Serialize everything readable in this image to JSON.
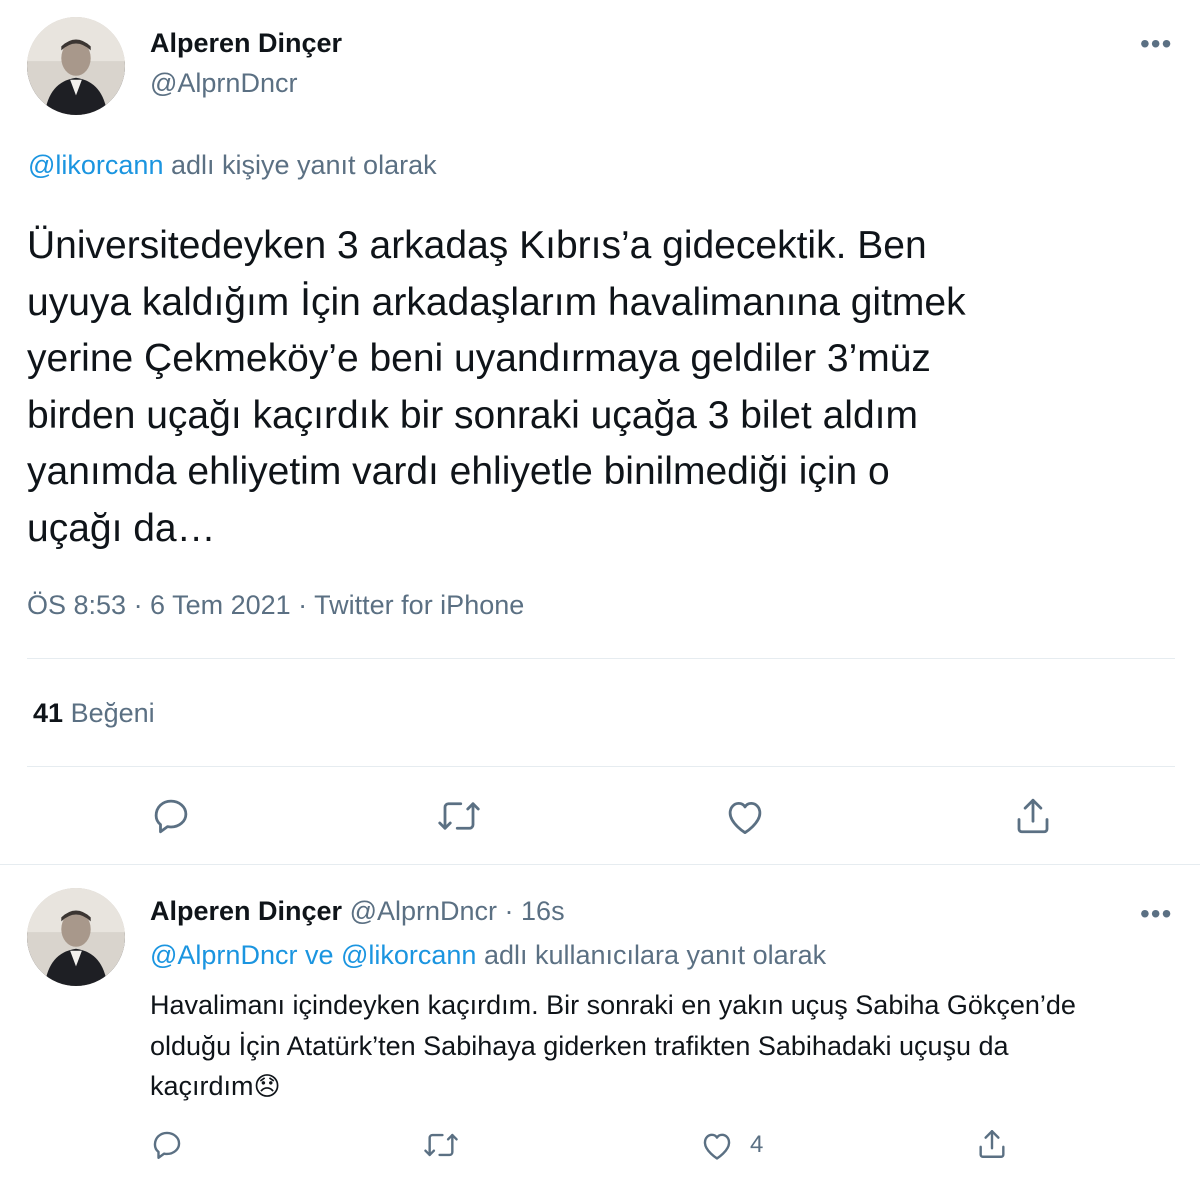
{
  "main_tweet": {
    "author_name": "Alperen Dinçer",
    "author_handle": "@AlprnDncr",
    "more_glyph": "•••",
    "reply_mention": "@likorcann",
    "reply_context_suffix": " adlı kişiye yanıt olarak",
    "text_lines": [
      "Üniversitedeyken 3 arkadaş Kıbrıs’a gidecektik. Ben",
      "uyuya kaldığım İçin arkadaşlarım havalimanına gitmek",
      "yerine Çekmeköy’e beni uyandırmaya geldiler 3’müz",
      "birden uçağı kaçırdık bir sonraki uçağa 3 bilet aldım",
      "yanımda ehliyetim vardı ehliyetle binilmediği için o",
      "uçağı da…"
    ],
    "meta": "ÖS 8:53 · 6 Tem 2021 · Twitter for iPhone",
    "likes_count": "41",
    "likes_label": "Beğeni"
  },
  "reply_tweet": {
    "author_name": "Alperen Dinçer",
    "author_handle": "@AlprnDncr",
    "time": "· 16s",
    "more_glyph": "•••",
    "mention_1": "@AlprnDncr",
    "mention_join": " ve ",
    "mention_2": "@likorcann",
    "reply_context_suffix": " adlı kullanıcılara yanıt olarak",
    "text_lines": [
      "Havalimanı içindeyken kaçırdım. Bir sonraki en yakın uçuş Sabiha Gökçen’de",
      "olduğu İçin Atatürk’ten Sabihaya giderken trafikten Sabihadaki uçuşu da",
      "kaçırdım"
    ],
    "emoji": "😞",
    "like_count": "4"
  },
  "colors": {
    "accent": "#1b95e0",
    "muted": "#5b7083",
    "text": "#0f1419",
    "divider": "#e6ecf0"
  },
  "icons": [
    "reply-icon",
    "retweet-icon",
    "like-icon",
    "share-icon",
    "more-icon"
  ]
}
